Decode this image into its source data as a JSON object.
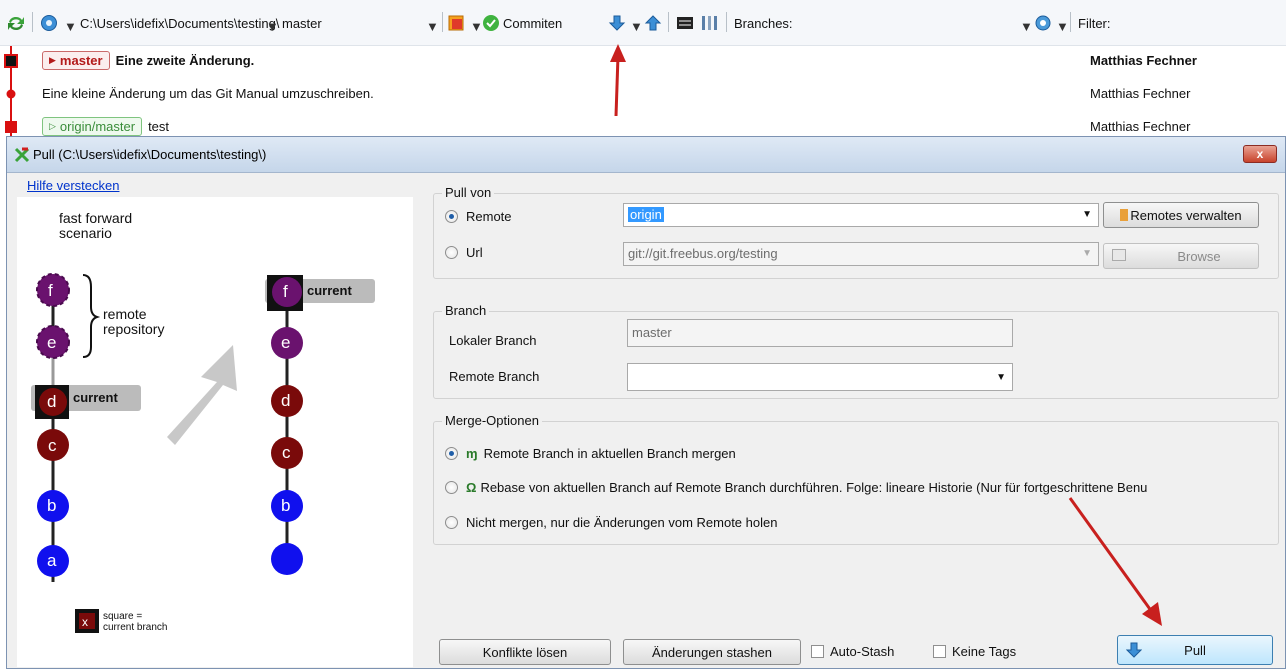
{
  "toolbar": {
    "path": "C:\\Users\\idefix\\Documents\\testing\\",
    "branch": "master",
    "commit_label": "Commiten",
    "branches_label": "Branches:",
    "filter_label": "Filter:"
  },
  "log": {
    "rows": [
      {
        "tag": "master",
        "message": "Eine zweite Änderung.",
        "author": "Matthias Fechner"
      },
      {
        "tag": "",
        "message": "Eine kleine Änderung um das Git Manual umzuschreiben.",
        "author": "Matthias Fechner"
      },
      {
        "tag": "origin/master",
        "message": "test",
        "author": "Matthias Fechner"
      }
    ]
  },
  "dialog": {
    "title": "Pull (C:\\Users\\idefix\\Documents\\testing\\)",
    "close_label": "x",
    "hide_help": "Hilfe verstecken",
    "help": {
      "scenario": "fast forward",
      "scenario2": "scenario",
      "remote": "remote",
      "repository": "repository",
      "current": "current",
      "legend_x": "x",
      "legend_text1": "square =",
      "legend_text2": "current branch",
      "nodes_left": [
        "f",
        "e",
        "d",
        "c",
        "b",
        "a"
      ],
      "nodes_right": [
        "f",
        "e",
        "d",
        "c",
        "b"
      ]
    },
    "pull_from": {
      "legend": "Pull von",
      "remote_label": "Remote",
      "remote_value": "origin",
      "manage_remotes": "Remotes verwalten",
      "url_label": "Url",
      "url_value": "git://git.freebus.org/testing",
      "browse": "Browse"
    },
    "branch": {
      "legend": "Branch",
      "local_label": "Lokaler Branch",
      "local_value": "master",
      "remote_label": "Remote Branch",
      "remote_value": ""
    },
    "merge": {
      "legend": "Merge-Optionen",
      "opt1": "Remote Branch in aktuellen Branch mergen",
      "opt2": "Rebase von aktuellen Branch auf Remote Branch durchführen. Folge: lineare Historie (Nur für fortgeschrittene Benu",
      "opt3": "Nicht mergen, nur die Änderungen vom Remote holen"
    },
    "buttons": {
      "resolve": "Konflikte lösen",
      "stash": "Änderungen stashen",
      "autostash": "Auto-Stash",
      "notags": "Keine Tags",
      "pull": "Pull"
    }
  },
  "colors": {
    "accent_red": "#c8201e",
    "commit_dark_red": "#7a0a0a",
    "commit_blue": "#1010ee",
    "commit_purple": "#5a0a6a"
  }
}
